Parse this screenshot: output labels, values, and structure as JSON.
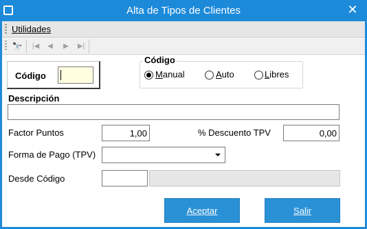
{
  "window": {
    "title": "Alta de Tipos de Clientes",
    "close": "✕"
  },
  "menu": {
    "utilidades": "Utilidades"
  },
  "toolbar": {
    "search_icon": "binoculars-icon",
    "first": "|◀",
    "prev": "◀",
    "next": "▶",
    "last": "▶|"
  },
  "code": {
    "label": "Código",
    "value": ""
  },
  "codigo_group": {
    "title": "Código",
    "options": [
      "Manual",
      "Auto",
      "Libres"
    ],
    "selected": "Manual"
  },
  "descripcion": {
    "label": "Descripción",
    "value": ""
  },
  "factor_puntos": {
    "label": "Factor Puntos",
    "value": "1,00"
  },
  "descuento_tpv": {
    "label": "% Descuento TPV",
    "value": "0,00"
  },
  "forma_pago": {
    "label": "Forma de Pago (TPV)",
    "value": ""
  },
  "desde_codigo": {
    "label": "Desde Código",
    "value": "",
    "description": ""
  },
  "buttons": {
    "aceptar": "Aceptar",
    "salir": "Salir"
  },
  "colors": {
    "titlebar": "#1d8ad9",
    "button": "#2a91d6",
    "code_input_bg": "#ffffe0"
  }
}
